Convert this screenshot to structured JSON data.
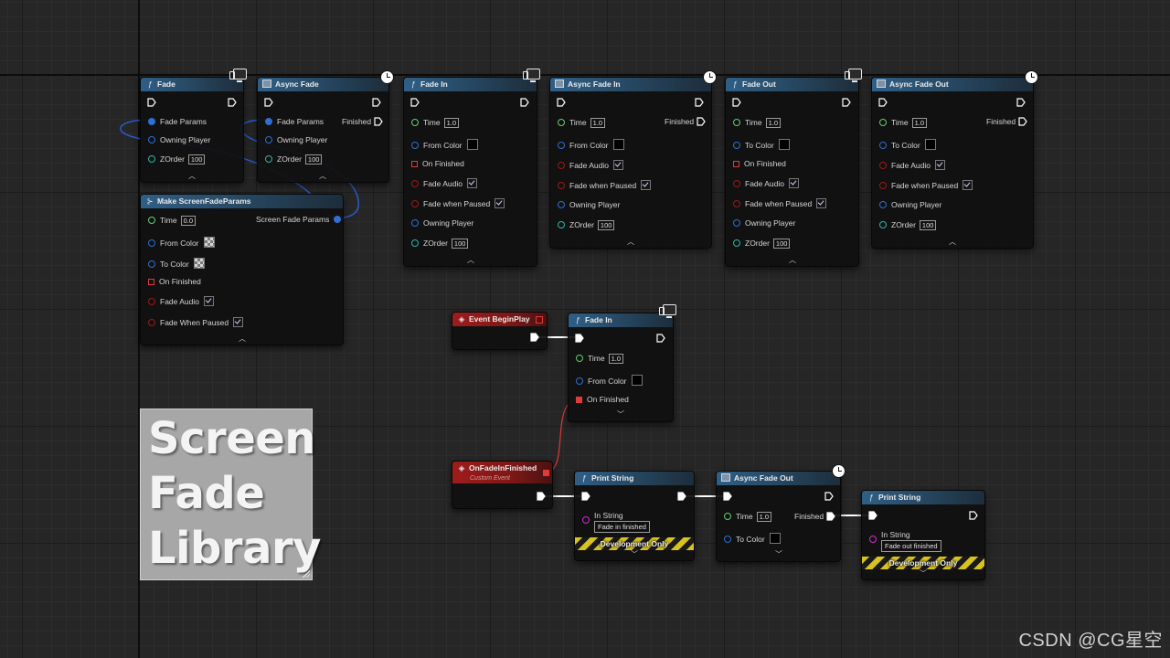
{
  "nodes": {
    "fade": {
      "title": "Fade",
      "icon": "function-icon",
      "pins": {
        "p1": "Fade Params",
        "p2": "Owning Player",
        "p3": "ZOrder",
        "v3": "100"
      }
    },
    "async_fade": {
      "title": "Async Fade",
      "icon": "function-box-icon",
      "pins": {
        "p1": "Fade Params",
        "p2": "Owning Player",
        "p3": "ZOrder",
        "v3": "100",
        "out": "Finished"
      }
    },
    "fade_in": {
      "title": "Fade In",
      "pins": {
        "time": "Time",
        "time_v": "1.0",
        "color": "From Color",
        "onfin": "On Finished",
        "audio": "Fade Audio",
        "paused": "Fade when Paused",
        "owner": "Owning Player",
        "z": "ZOrder",
        "z_v": "100"
      }
    },
    "async_fade_in": {
      "title": "Async Fade In",
      "pins": {
        "time": "Time",
        "time_v": "1.0",
        "out": "Finished",
        "color": "From Color",
        "audio": "Fade Audio",
        "paused": "Fade when Paused",
        "owner": "Owning Player",
        "z": "ZOrder",
        "z_v": "100"
      }
    },
    "fade_out": {
      "title": "Fade Out",
      "pins": {
        "time": "Time",
        "time_v": "1.0",
        "color": "To Color",
        "onfin": "On Finished",
        "audio": "Fade Audio",
        "paused": "Fade when Paused",
        "owner": "Owning Player",
        "z": "ZOrder",
        "z_v": "100"
      }
    },
    "async_fade_out": {
      "title": "Async Fade Out",
      "pins": {
        "time": "Time",
        "time_v": "1.0",
        "out": "Finished",
        "color": "To Color",
        "audio": "Fade Audio",
        "paused": "Fade when Paused",
        "owner": "Owning Player",
        "z": "ZOrder",
        "z_v": "100"
      }
    },
    "make_params": {
      "title": "Make ScreenFadeParams",
      "pins": {
        "time": "Time",
        "time_v": "0.0",
        "out": "Screen Fade Params",
        "from": "From Color",
        "to": "To Color",
        "onfin": "On Finished",
        "audio": "Fade Audio",
        "paused": "Fade When Paused"
      }
    },
    "begin_play": {
      "title": "Event BeginPlay"
    },
    "fade_in_2": {
      "title": "Fade In",
      "pins": {
        "time": "Time",
        "time_v": "1.0",
        "color": "From Color",
        "onfin": "On Finished"
      }
    },
    "on_fade_in_finished": {
      "title": "OnFadeInFinished",
      "subtitle": "Custom Event"
    },
    "print1": {
      "title": "Print String",
      "in": "In String",
      "value": "Fade in finished",
      "dev": "Development Only"
    },
    "async_fade_out_2": {
      "title": "Async Fade Out",
      "pins": {
        "time": "Time",
        "time_v": "1.0",
        "out": "Finished",
        "color": "To Color"
      }
    },
    "print2": {
      "title": "Print String",
      "in": "In String",
      "value": "Fade out finished",
      "dev": "Development Only"
    }
  },
  "title_card": {
    "line1": "Screen",
    "line2": "Fade",
    "line3": "Library"
  },
  "watermark": "CSDN @CG星空",
  "colors": {
    "function_header": "#2f5f86",
    "event_header": "#9e1c1c",
    "exec": "#ffffff",
    "float_pin": "#5fd26b",
    "struct_pin": "#2f6fd0",
    "bool_pin": "#9a1a1a",
    "int_pin": "#2fb7a4",
    "string_pin": "#d22ed2",
    "delegate_pin": "#e03a3a"
  }
}
